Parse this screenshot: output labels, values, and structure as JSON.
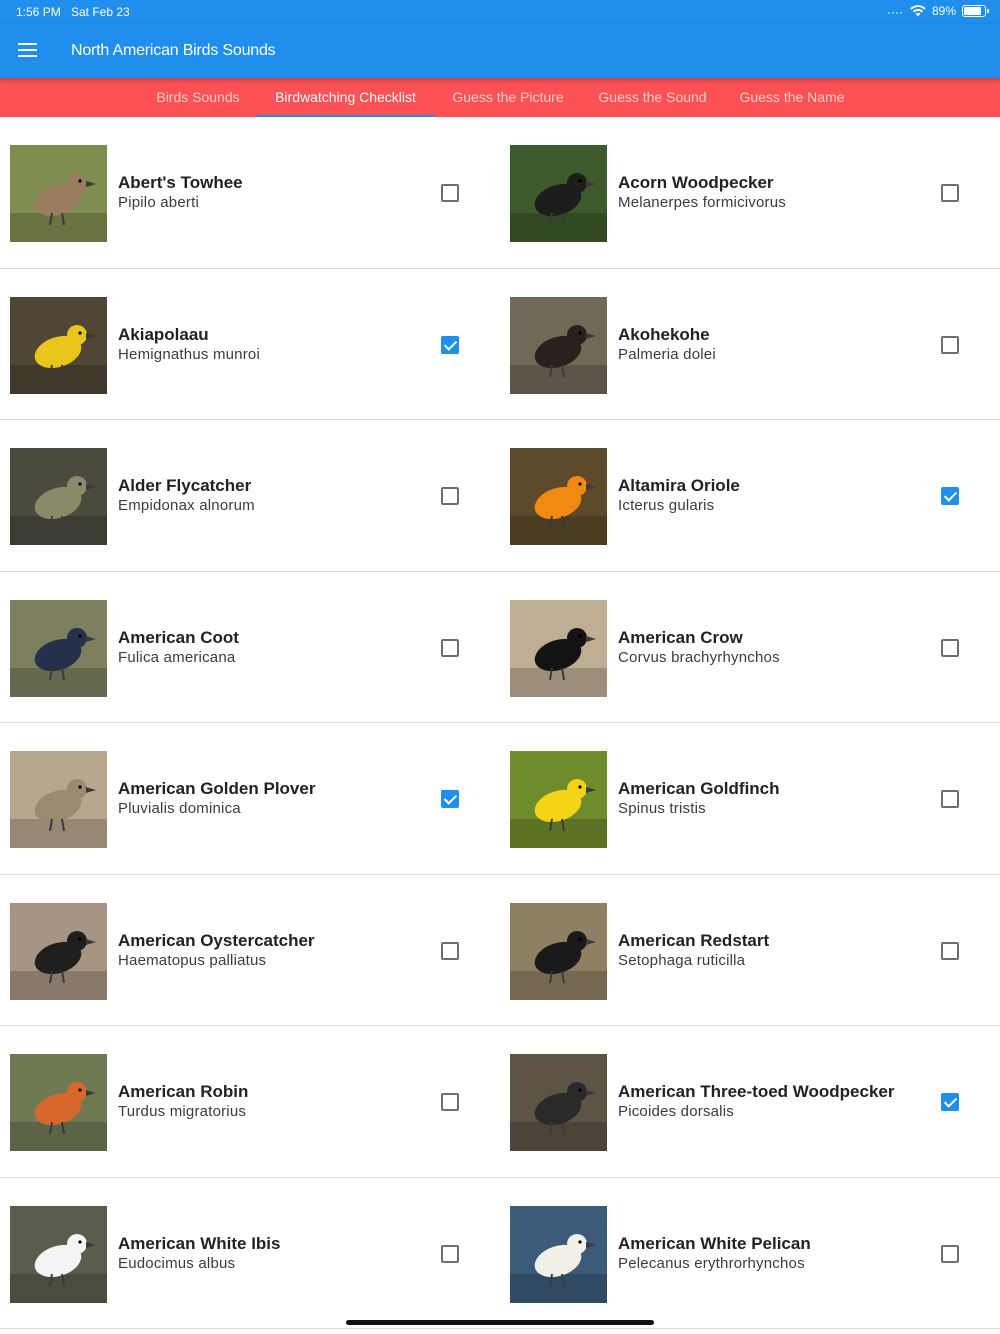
{
  "status_bar": {
    "time": "1:56 PM",
    "date": "Sat Feb 23",
    "battery": "89%",
    "battery_level": 0.89
  },
  "app_bar": {
    "title": "North American Birds Sounds"
  },
  "tabs": [
    {
      "label": "Birds Sounds",
      "active": false
    },
    {
      "label": "Birdwatching Checklist",
      "active": true
    },
    {
      "label": "Guess the Picture",
      "active": false
    },
    {
      "label": "Guess the Sound",
      "active": false
    },
    {
      "label": "Guess the Name",
      "active": false
    }
  ],
  "birds": [
    {
      "common": "Abert's Towhee",
      "scientific": "Pipilo aberti",
      "checked": false,
      "icon": "brown-songbird-photo"
    },
    {
      "common": "Acorn Woodpecker",
      "scientific": "Melanerpes formicivorus",
      "checked": false,
      "icon": "woodpecker-photo"
    },
    {
      "common": "Akiapolaau",
      "scientific": "Hemignathus munroi",
      "checked": true,
      "icon": "yellow-bird-photo"
    },
    {
      "common": "Akohekohe",
      "scientific": "Palmeria dolei",
      "checked": false,
      "icon": "dark-crested-bird-photo"
    },
    {
      "common": "Alder Flycatcher",
      "scientific": "Empidonax alnorum",
      "checked": false,
      "icon": "flycatcher-photo"
    },
    {
      "common": "Altamira Oriole",
      "scientific": "Icterus gularis",
      "checked": true,
      "icon": "orange-oriole-photo"
    },
    {
      "common": "American Coot",
      "scientific": "Fulica americana",
      "checked": false,
      "icon": "coot-photo"
    },
    {
      "common": "American Crow",
      "scientific": "Corvus brachyrhynchos",
      "checked": false,
      "icon": "crow-photo"
    },
    {
      "common": "American Golden Plover",
      "scientific": "Pluvialis dominica",
      "checked": true,
      "icon": "plover-photo"
    },
    {
      "common": "American Goldfinch",
      "scientific": "Spinus tristis",
      "checked": false,
      "icon": "goldfinch-photo"
    },
    {
      "common": "American Oystercatcher",
      "scientific": "Haematopus palliatus",
      "checked": false,
      "icon": "oystercatcher-photo"
    },
    {
      "common": "American Redstart",
      "scientific": "Setophaga ruticilla",
      "checked": false,
      "icon": "redstart-photo"
    },
    {
      "common": "American Robin",
      "scientific": "Turdus migratorius",
      "checked": false,
      "icon": "robin-photo"
    },
    {
      "common": "American Three-toed Woodpecker",
      "scientific": "Picoides dorsalis",
      "checked": true,
      "icon": "three-toed-woodpecker-photo"
    },
    {
      "common": "American White Ibis",
      "scientific": "Eudocimus albus",
      "checked": false,
      "icon": "ibis-photo"
    },
    {
      "common": "American White Pelican",
      "scientific": "Pelecanus erythrorhynchos",
      "checked": false,
      "icon": "pelican-photo"
    }
  ],
  "colors": {
    "app_bar": "#1f8eed",
    "tab_bar": "#fc5155",
    "checkbox_checked": "#1f8eed",
    "photo_backgrounds": [
      "#7f8d50",
      "#3d5a2c",
      "#4f4636",
      "#6f6a57",
      "#4b4a3f",
      "#5c4a2a",
      "#7d7f5f",
      "#bfae94",
      "#b7a78f",
      "#6f8c2c",
      "#a79483",
      "#8f7f63",
      "#6f7a55",
      "#5d5446",
      "#5a5d4e",
      "#3b5b79"
    ],
    "bird_bodies": [
      "#9a7c5e",
      "#1d1d1d",
      "#e8c61a",
      "#2a2020",
      "#8a8a6a",
      "#f08a10",
      "#25304a",
      "#141414",
      "#9a8a6e",
      "#f3d417",
      "#1f1f1f",
      "#1a1a1a",
      "#d5682a",
      "#2a2a2a",
      "#f4f4f4",
      "#f2efe6"
    ]
  }
}
